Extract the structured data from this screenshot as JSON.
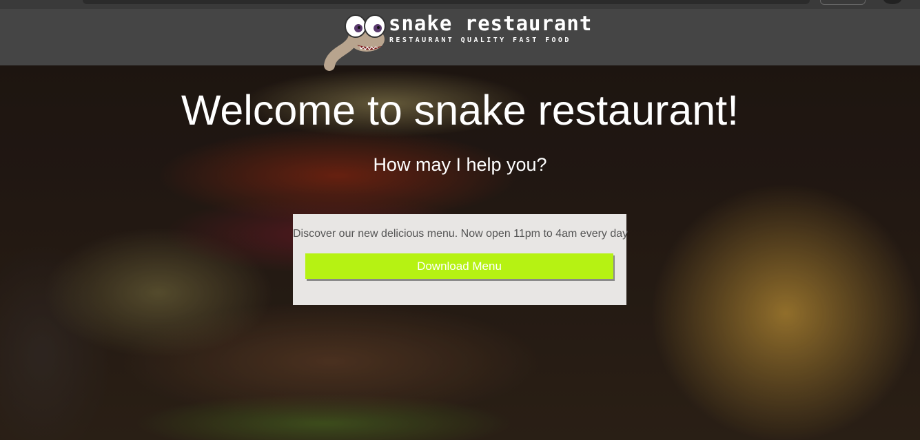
{
  "site": {
    "brand_name": "snake restaurant",
    "tagline": "RESTAURANT QUALITY FAST FOOD",
    "logo_icon": "snake-mascot-icon"
  },
  "hero": {
    "title": "Welcome to snake restaurant!",
    "subtitle": "How may I help you?"
  },
  "promo": {
    "text": "Discover our new delicious menu. Now open 11pm to 4am every day",
    "button_label": "Download Menu"
  },
  "colors": {
    "header_bg": "#454545",
    "button_bg": "#b6f213",
    "card_bg": "#e8e6e4",
    "text_on_dark": "#ffffff"
  }
}
